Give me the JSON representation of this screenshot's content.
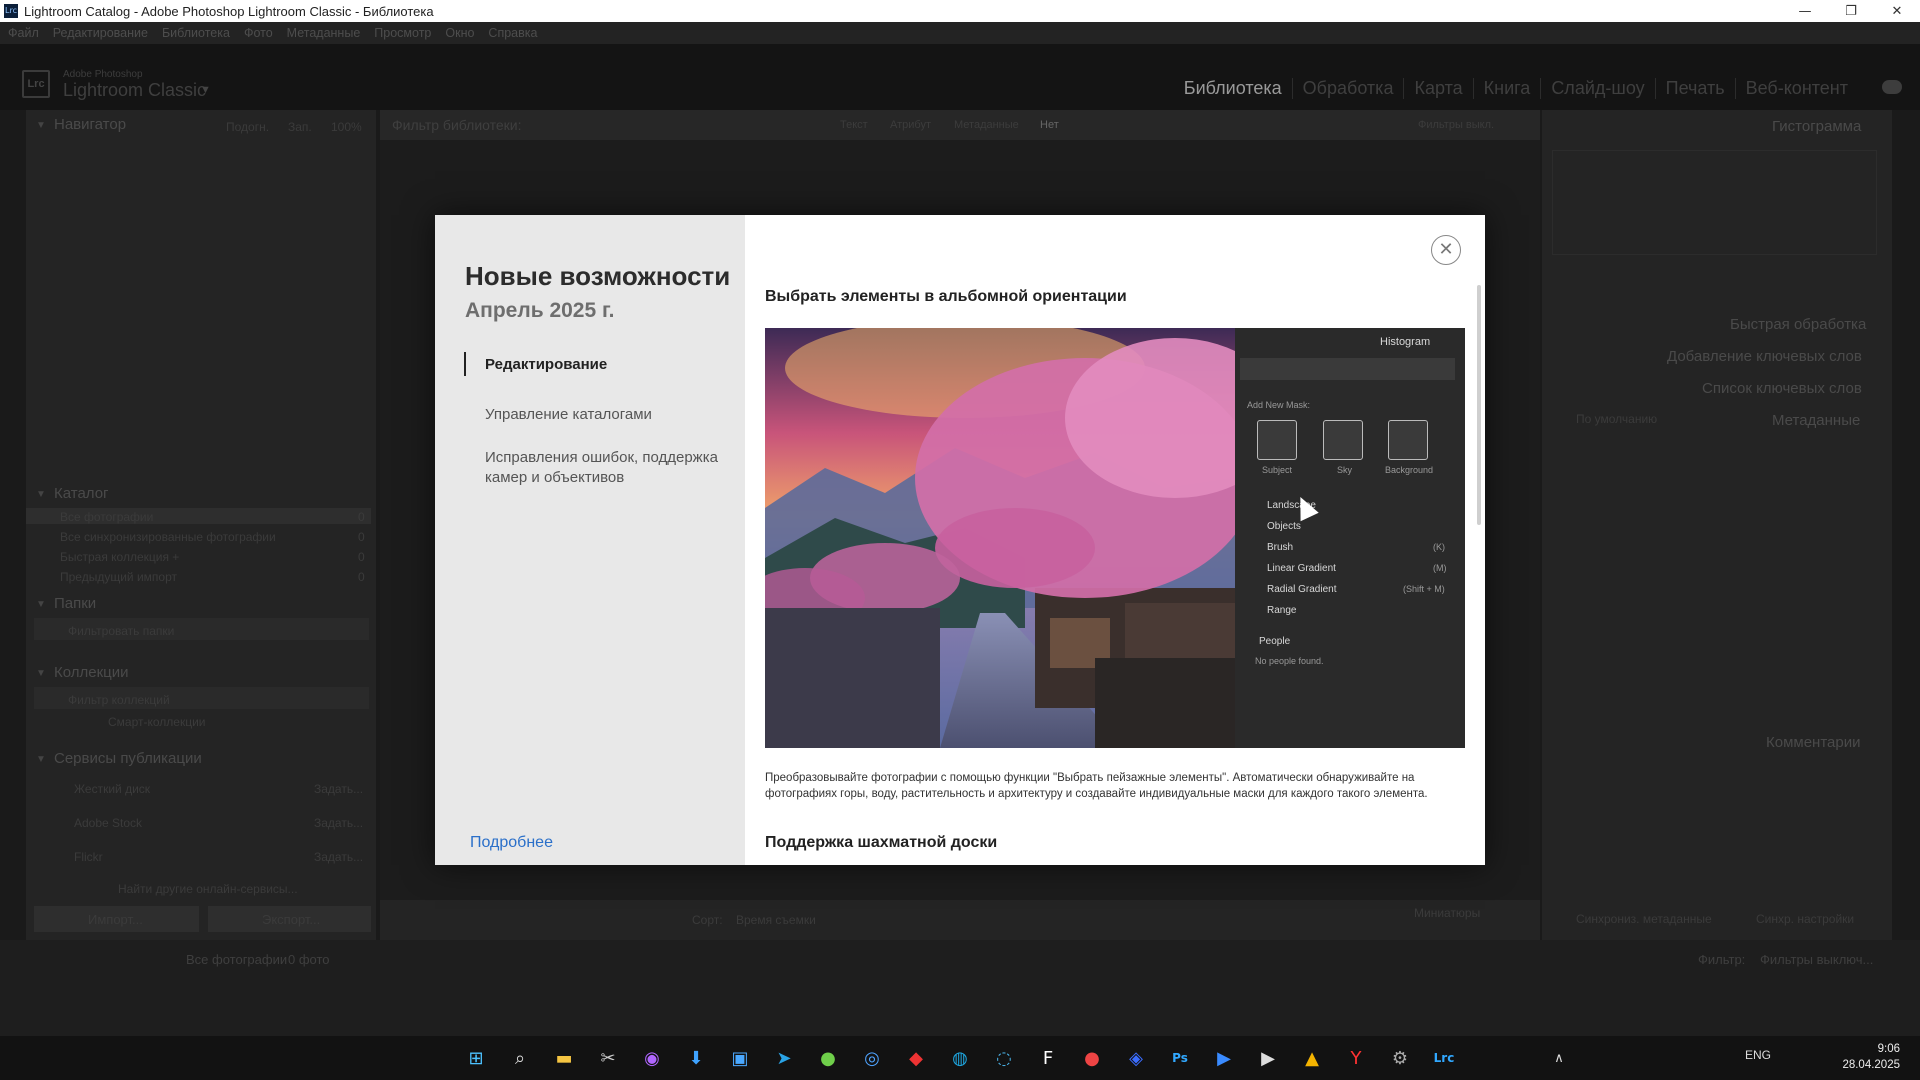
{
  "window": {
    "title": "Lightroom Catalog - Adobe Photoshop Lightroom Classic - Библиотека",
    "app_icon": "Lrc",
    "controls": [
      "—",
      "❐",
      "✕"
    ]
  },
  "menu": [
    "Файл",
    "Редактирование",
    "Библиотека",
    "Фото",
    "Метаданные",
    "Просмотр",
    "Окно",
    "Справка"
  ],
  "header": {
    "logo": "Lrc",
    "brand_small": "Adobe Photoshop",
    "brand_big": "Lightroom Classic",
    "modules": [
      "Библиотека",
      "Обработка",
      "Карта",
      "Книга",
      "Слайд-шоу",
      "Печать",
      "Веб-контент"
    ],
    "active_module": "Библиотека"
  },
  "left_panel": {
    "navigator": "Навигатор",
    "nav_opts": [
      "Подогн.",
      "Зап.",
      "100%"
    ],
    "catalog": "Каталог",
    "catalog_items": [
      {
        "label": "Все фотографии",
        "count": "0"
      },
      {
        "label": "Все синхронизированные фотографии",
        "count": "0"
      },
      {
        "label": "Быстрая коллекция +",
        "count": "0"
      },
      {
        "label": "Предыдущий импорт",
        "count": "0"
      }
    ],
    "folders": "Папки",
    "folders_filter": "Фильтровать папки",
    "collections": "Коллекции",
    "collections_filter": "Фильтр коллекций",
    "smart_collections": "Смарт-коллекции",
    "publish": "Сервисы публикации",
    "publish_items": [
      {
        "label": "Жесткий диск",
        "action": "Задать..."
      },
      {
        "label": "Adobe Stock",
        "action": "Задать..."
      },
      {
        "label": "Flickr",
        "action": "Задать..."
      }
    ],
    "find_more": "Найти другие онлайн-сервисы...",
    "import_btn": "Импорт...",
    "export_btn": "Экспорт..."
  },
  "filter_bar": {
    "label": "Фильтр библиотеки:",
    "options": [
      "Текст",
      "Атрибут",
      "Метаданные",
      "Нет"
    ],
    "right": "Фильтры выкл."
  },
  "toolbar": {
    "sort_label": "Сорт:",
    "sort_value": "Время съемки",
    "thumbs_label": "Миниатюры"
  },
  "right_panel": {
    "histogram": "Гистограмма",
    "quick_develop": "Быстрая обработка",
    "keywording": "Добавление ключевых слов",
    "keyword_list": "Список ключевых слов",
    "metadata": "Метаданные",
    "metadata_preset": "По умолчанию",
    "comments": "Комментарии",
    "sync_meta": "Синхрониз. метаданные",
    "sync_settings": "Синхр. настройки"
  },
  "filmstrip": {
    "source": "Все фотографии",
    "count": "0 фото",
    "filter_label": "Фильтр:",
    "filter_value": "Фильтры выключ..."
  },
  "dialog": {
    "title": "Новые возможности",
    "subtitle": "Апрель 2025 г.",
    "nav": [
      {
        "label": "Редактирование",
        "active": true
      },
      {
        "label": "Управление каталогами",
        "active": false
      },
      {
        "label": "Исправления ошибок, поддержка камер и объективов",
        "active": false
      }
    ],
    "learn_more": "Подробнее",
    "close": "✕",
    "section1_title": "Выбрать элементы в альбомной ориентации",
    "section1_desc": "Преобразовывайте фотографии с помощью функции \"Выбрать пейзажные элементы\". Автоматически обнаруживайте на фотографиях горы, воду, растительность и архитектуру и создавайте индивидуальные маски для каждого такого элемента.",
    "section2_title": "Поддержка шахматной доски",
    "hero_panel": {
      "header": "Histogram",
      "add_mask": "Add New Mask:",
      "masks": [
        "Subject",
        "Sky",
        "Background"
      ],
      "tools": [
        {
          "label": "Landscape",
          "key": ""
        },
        {
          "label": "Objects",
          "key": ""
        },
        {
          "label": "Brush",
          "key": "(K)"
        },
        {
          "label": "Linear Gradient",
          "key": "(M)"
        },
        {
          "label": "Radial Gradient",
          "key": "(Shift + M)"
        },
        {
          "label": "Range",
          "key": ""
        }
      ],
      "people": "People",
      "no_people": "No people found."
    }
  },
  "taskbar": {
    "lang": "ENG",
    "time": "9:06",
    "date": "28.04.2025"
  }
}
